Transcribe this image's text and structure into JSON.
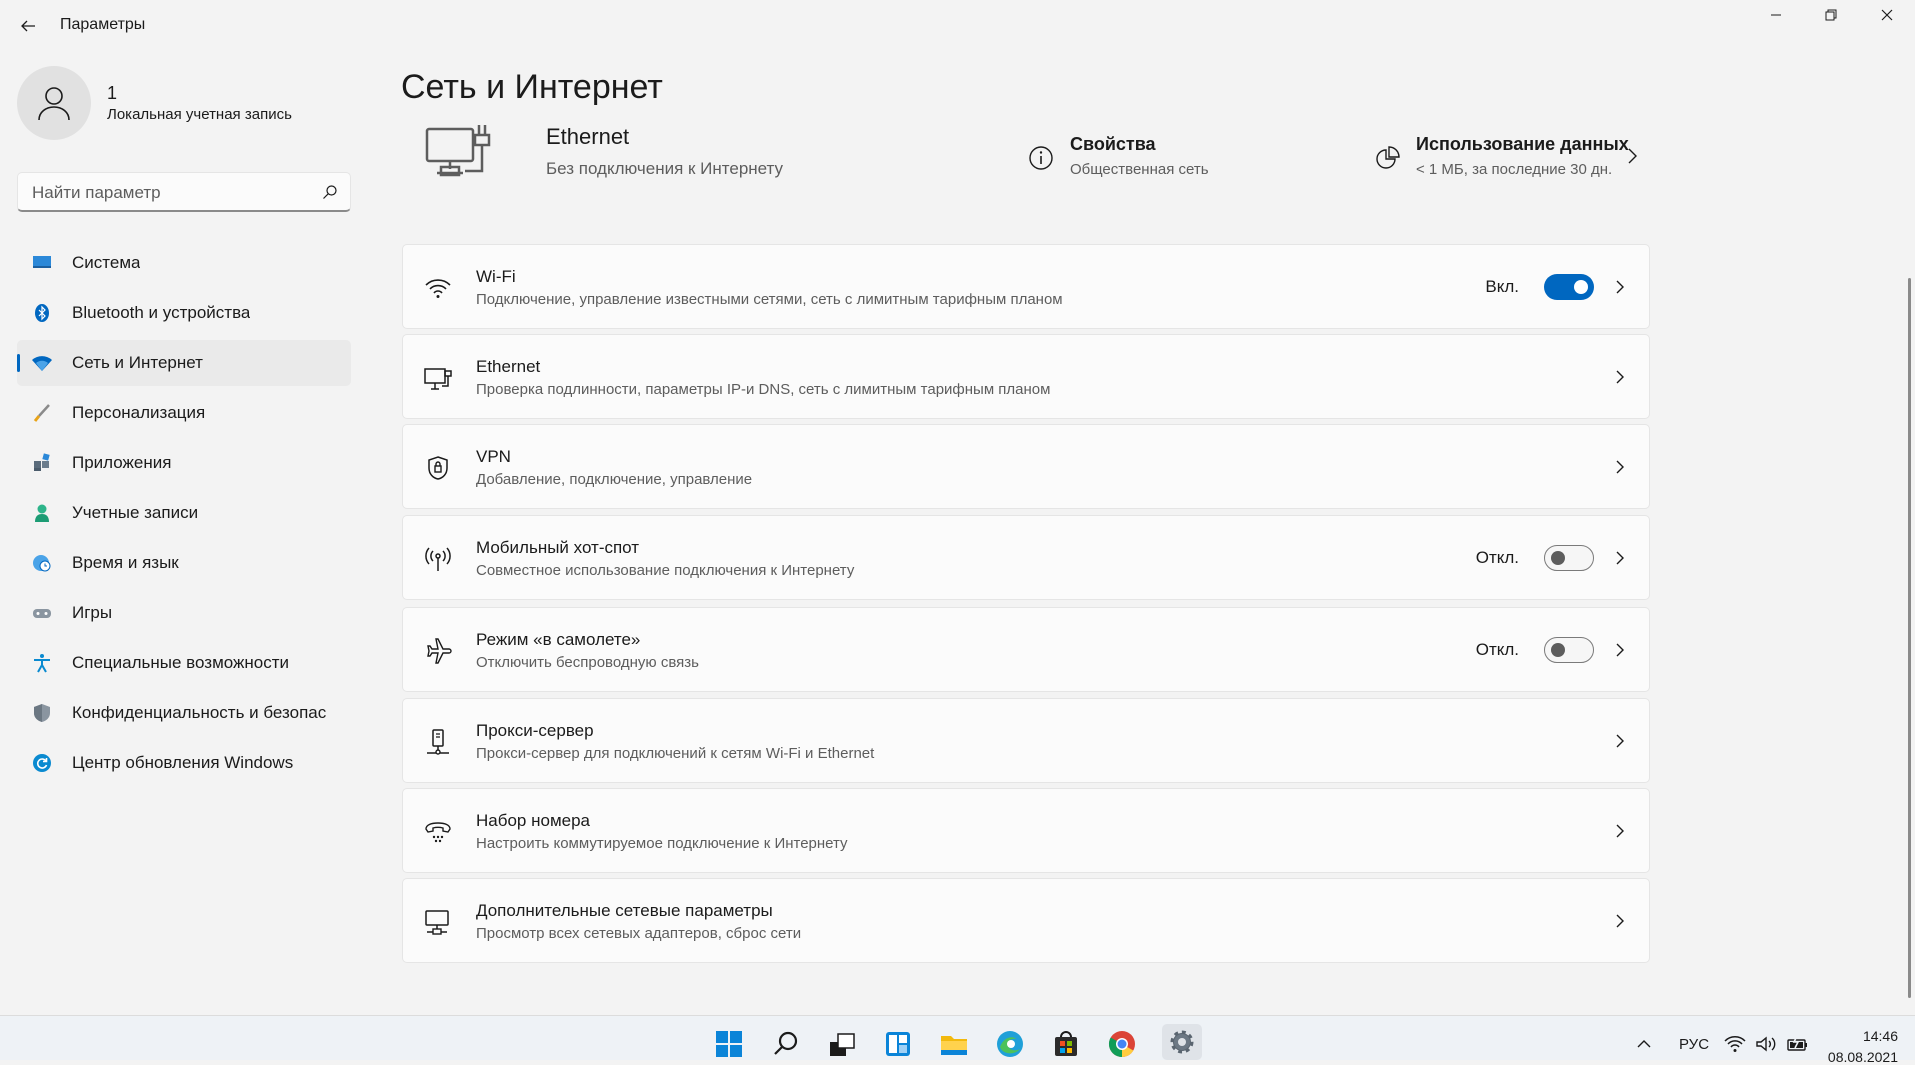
{
  "window": {
    "title": "Параметры"
  },
  "profile": {
    "name": "1",
    "account_type": "Локальная учетная запись"
  },
  "search": {
    "placeholder": "Найти параметр"
  },
  "nav": [
    {
      "label": "Система",
      "icon": "monitor-icon",
      "active": false
    },
    {
      "label": "Bluetooth и устройства",
      "icon": "bluetooth-icon",
      "active": false
    },
    {
      "label": "Сеть и Интернет",
      "icon": "wifi-icon",
      "active": true
    },
    {
      "label": "Персонализация",
      "icon": "brush-icon",
      "active": false
    },
    {
      "label": "Приложения",
      "icon": "apps-icon",
      "active": false
    },
    {
      "label": "Учетные записи",
      "icon": "person-icon",
      "active": false
    },
    {
      "label": "Время и язык",
      "icon": "globe-clock-icon",
      "active": false
    },
    {
      "label": "Игры",
      "icon": "gamepad-icon",
      "active": false
    },
    {
      "label": "Специальные возможности",
      "icon": "accessibility-icon",
      "active": false
    },
    {
      "label": "Конфиденциальность и безопас",
      "icon": "shield-icon",
      "active": false
    },
    {
      "label": "Центр обновления Windows",
      "icon": "update-icon",
      "active": false
    }
  ],
  "main": {
    "title": "Сеть и Интернет",
    "ethernet": {
      "title": "Ethernet",
      "status": "Без подключения к Интернету"
    },
    "properties": {
      "title": "Свойства",
      "subtitle": "Общественная сеть"
    },
    "data_usage": {
      "title": "Использование данных",
      "subtitle": "< 1 МБ, за последние 30 дн."
    },
    "cards": [
      {
        "title": "Wi-Fi",
        "subtitle": "Подключение, управление известными сетями, сеть с лимитным тарифным планом",
        "icon": "wifi-icon",
        "toggle": "on",
        "toggle_label": "Вкл."
      },
      {
        "title": "Ethernet",
        "subtitle": "Проверка подлинности, параметры IP-и DNS, сеть с лимитным тарифным планом",
        "icon": "ethernet-icon"
      },
      {
        "title": "VPN",
        "subtitle": "Добавление, подключение, управление",
        "icon": "vpn-shield-icon"
      },
      {
        "title": "Мобильный хот-спот",
        "subtitle": "Совместное использование подключения к Интернету",
        "icon": "hotspot-icon",
        "toggle": "off",
        "toggle_label": "Откл."
      },
      {
        "title": "Режим «в самолете»",
        "subtitle": "Отключить беспроводную связь",
        "icon": "airplane-icon",
        "toggle": "off",
        "toggle_label": "Откл."
      },
      {
        "title": "Прокси-сервер",
        "subtitle": "Прокси-сервер для подключений к сетям Wi-Fi и Ethernet",
        "icon": "proxy-icon"
      },
      {
        "title": "Набор номера",
        "subtitle": "Настроить коммутируемое подключение к Интернету",
        "icon": "dialup-icon"
      },
      {
        "title": "Дополнительные сетевые параметры",
        "subtitle": "Просмотр всех сетевых адаптеров, сброс сети",
        "icon": "network-adapter-icon"
      }
    ]
  },
  "taskbar": {
    "language": "РУС",
    "time": "14:46",
    "date": "08.08.2021",
    "apps": [
      "start-icon",
      "search-icon",
      "task-view-icon",
      "widgets-icon",
      "file-explorer-icon",
      "edge-icon",
      "store-icon",
      "chrome-icon",
      "settings-icon"
    ]
  },
  "colors": {
    "accent": "#0067c0",
    "background": "#f3f3f3",
    "card": "#fbfbfb"
  }
}
